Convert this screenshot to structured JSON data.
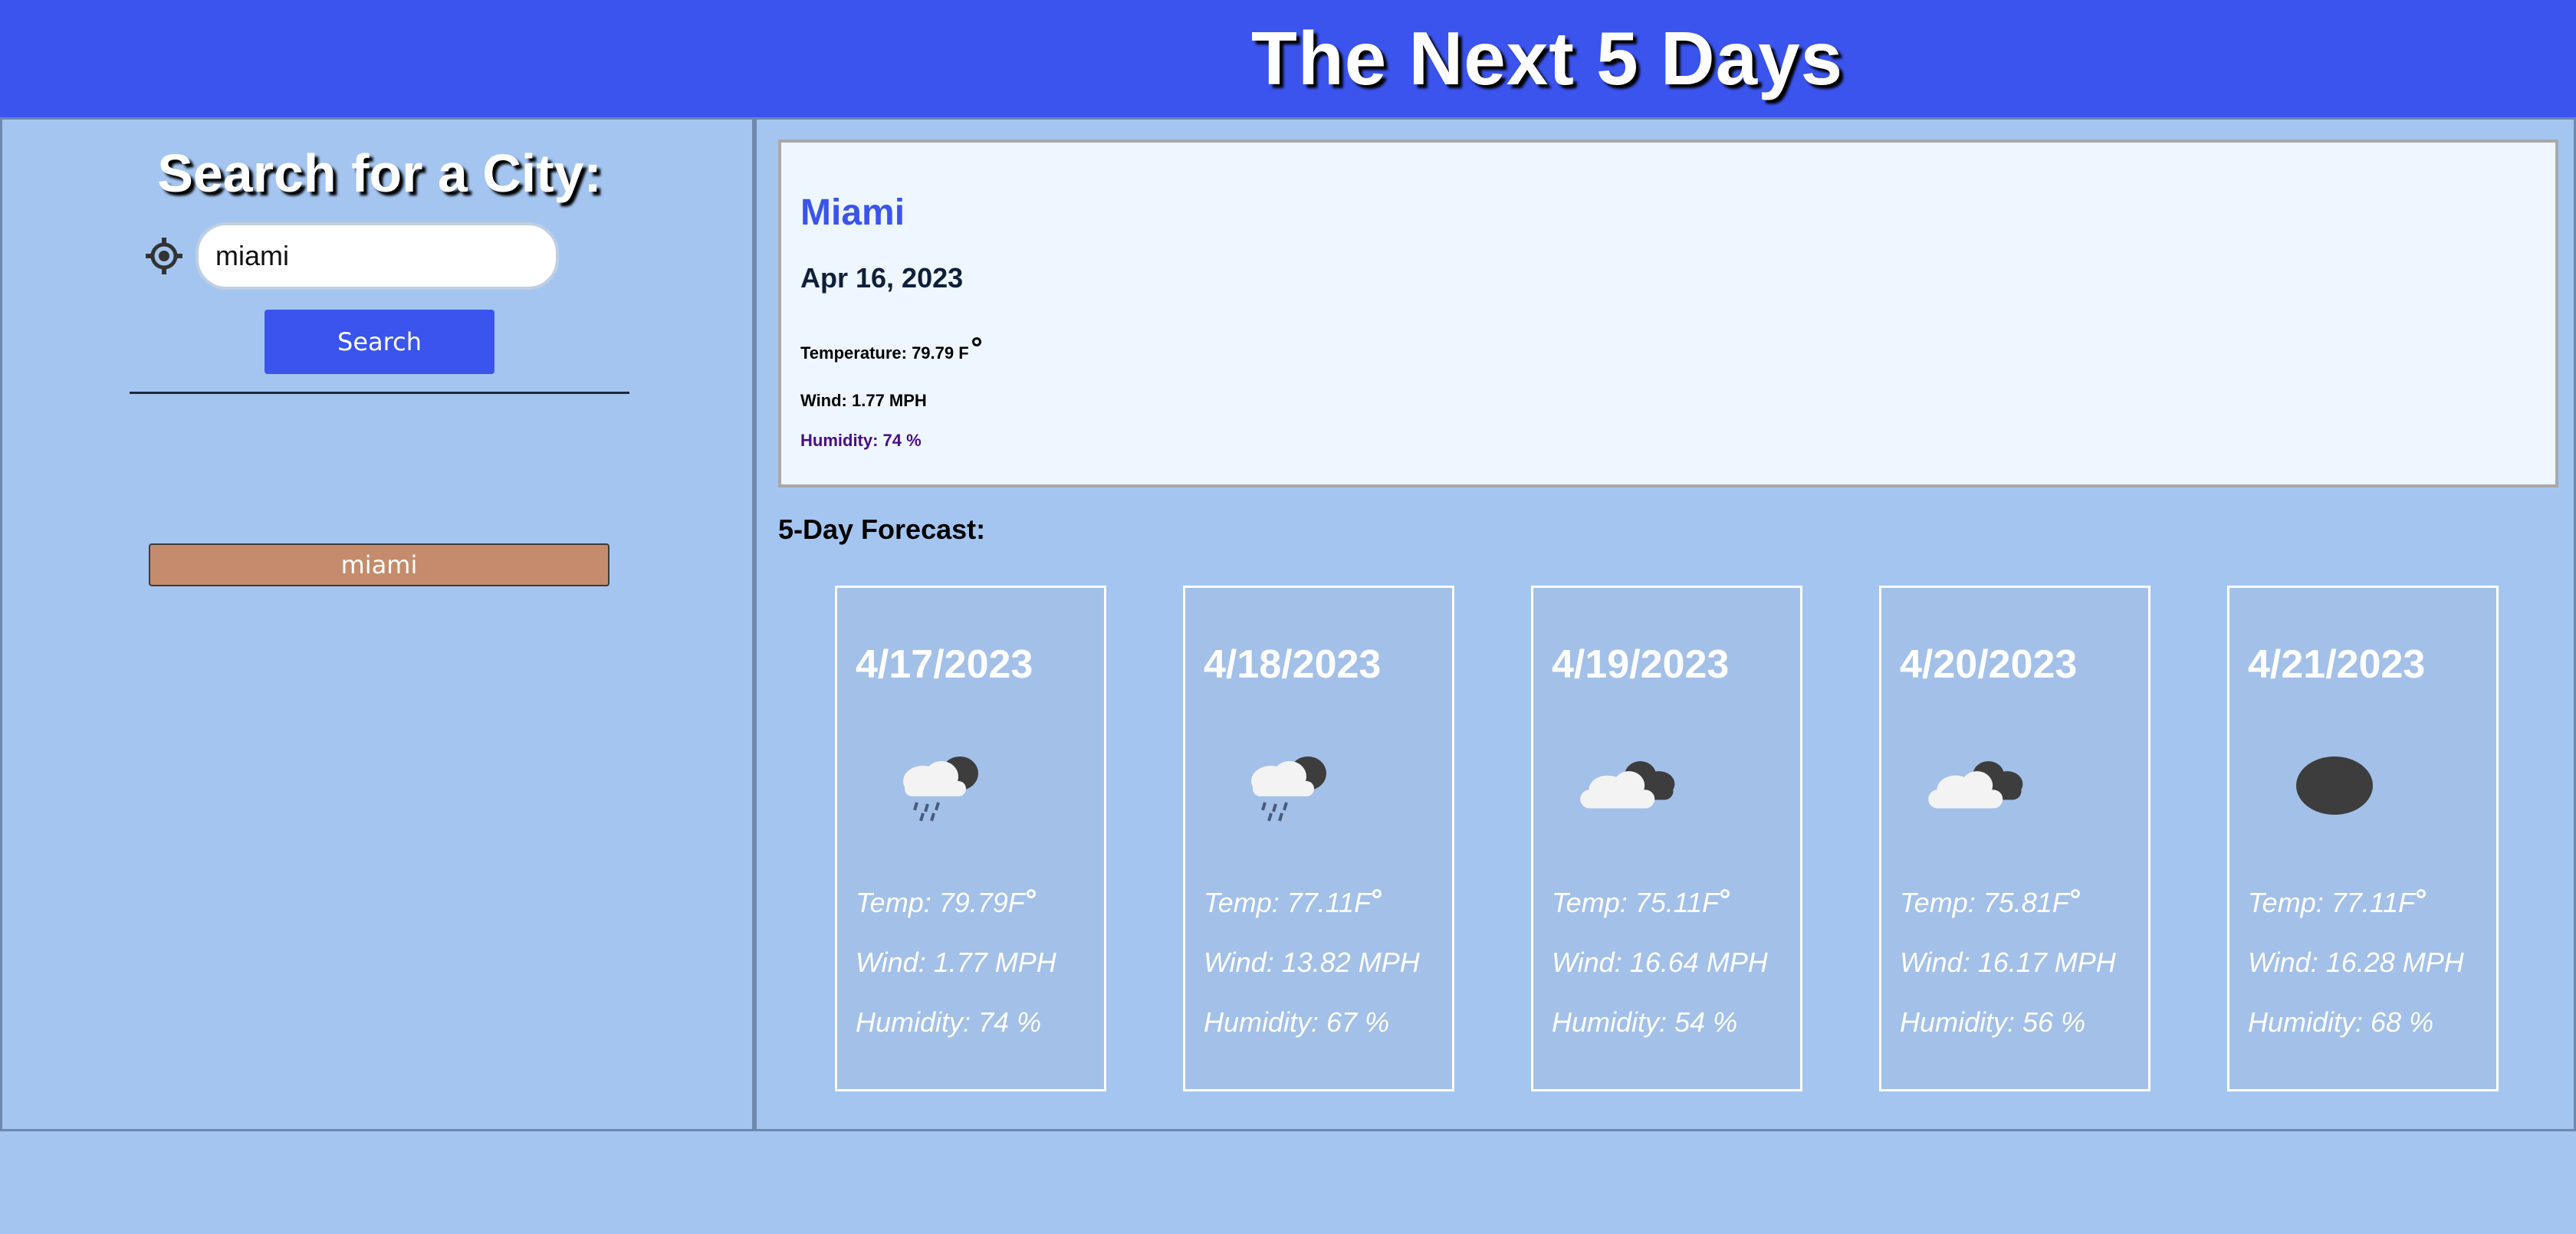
{
  "header": {
    "title": "The Next 5 Days"
  },
  "sidebar": {
    "title": "Search for a City:",
    "search": {
      "value": "miami",
      "placeholder": ""
    },
    "search_button": "Search",
    "history": [
      "miami"
    ]
  },
  "current": {
    "city": "Miami",
    "date": "Apr 16, 2023",
    "temperature": "Temperature: 79.79 F",
    "wind": "Wind: 1.77 MPH",
    "humidity": "Humidity: 74 %"
  },
  "forecast": {
    "label": "5-Day Forecast:",
    "days": [
      {
        "date": "4/17/2023",
        "icon": "rain-cloud-icon",
        "temp": "Temp: 79.79F",
        "wind": "Wind: 1.77 MPH",
        "humidity": "Humidity: 74 %"
      },
      {
        "date": "4/18/2023",
        "icon": "rain-cloud-icon",
        "temp": "Temp: 77.11F",
        "wind": "Wind: 13.82 MPH",
        "humidity": "Humidity: 67 %"
      },
      {
        "date": "4/19/2023",
        "icon": "broken-clouds-icon",
        "temp": "Temp: 75.11F",
        "wind": "Wind: 16.64 MPH",
        "humidity": "Humidity: 54 %"
      },
      {
        "date": "4/20/2023",
        "icon": "broken-clouds-icon",
        "temp": "Temp: 75.81F",
        "wind": "Wind: 16.17 MPH",
        "humidity": "Humidity: 56 %"
      },
      {
        "date": "4/21/2023",
        "icon": "overcast-clouds-icon",
        "temp": "Temp: 77.11F",
        "wind": "Wind: 16.28 MPH",
        "humidity": "Humidity: 68 %"
      }
    ]
  },
  "colors": {
    "header_bg": "#3b54ee",
    "page_bg": "#a4c5f0",
    "history_button": "#c48c6c",
    "city_name": "#3b54ee"
  }
}
